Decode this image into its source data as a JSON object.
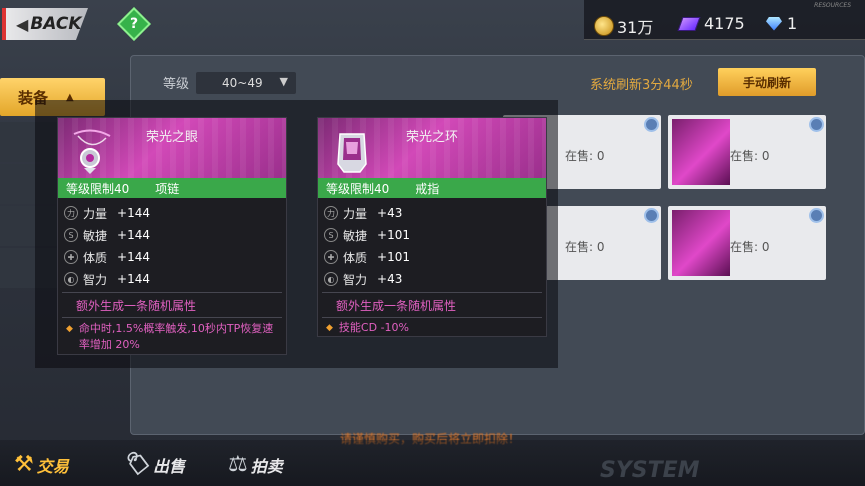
{
  "topbar": {
    "back_label": "BACK",
    "help_glyph": "?",
    "resources_label": "RESOURCES",
    "gold": "31万",
    "crystal": "4175",
    "diamond": "1"
  },
  "sidebar": {
    "active_tab": "装备"
  },
  "filter": {
    "level_label": "等级",
    "level_value": "40~49"
  },
  "refresh": {
    "timer_text": "系统刷新3分44秒",
    "button_label": "手动刷新"
  },
  "grid_cards": [
    {
      "stock_label": "在售:",
      "stock_value": "0"
    },
    {
      "stock_label": "在售:",
      "stock_value": "0"
    },
    {
      "stock_label": "在售:",
      "stock_value": "0"
    },
    {
      "stock_label": "在售:",
      "stock_value": "0"
    }
  ],
  "warning_text": "请谨慎购买，购买后将立即扣除！",
  "bottom_nav": [
    {
      "label": "交易",
      "icon": "gavel-icon",
      "active": true
    },
    {
      "label": "出售",
      "icon": "tag-icon",
      "active": false
    },
    {
      "label": "拍卖",
      "icon": "auction-icon",
      "active": false
    }
  ],
  "system_text": "SYSTEM",
  "tooltips": [
    {
      "name": "荣光之眼",
      "level_limit": "等级限制40",
      "slot": "项链",
      "stats": [
        {
          "label": "力量",
          "value": "+144",
          "icon": "strength-icon"
        },
        {
          "label": "敏捷",
          "value": "+144",
          "icon": "agility-icon"
        },
        {
          "label": "体质",
          "value": "+144",
          "icon": "vitality-icon"
        },
        {
          "label": "智力",
          "value": "+144",
          "icon": "intellect-icon"
        }
      ],
      "extra": "额外生成一条随机属性",
      "effect": "命中时,1.5%概率触发,10秒内TP恢复速率增加 20%"
    },
    {
      "name": "荣光之环",
      "level_limit": "等级限制40",
      "slot": "戒指",
      "stats": [
        {
          "label": "力量",
          "value": "+43",
          "icon": "strength-icon"
        },
        {
          "label": "敏捷",
          "value": "+101",
          "icon": "agility-icon"
        },
        {
          "label": "体质",
          "value": "+101",
          "icon": "vitality-icon"
        },
        {
          "label": "智力",
          "value": "+43",
          "icon": "intellect-icon"
        }
      ],
      "extra": "额外生成一条随机属性",
      "effect": "技能CD -10%"
    }
  ],
  "colors": {
    "accent_gold": "#ffc03a",
    "rarity_pink": "#e060c0",
    "limit_green": "#3aa84a"
  }
}
